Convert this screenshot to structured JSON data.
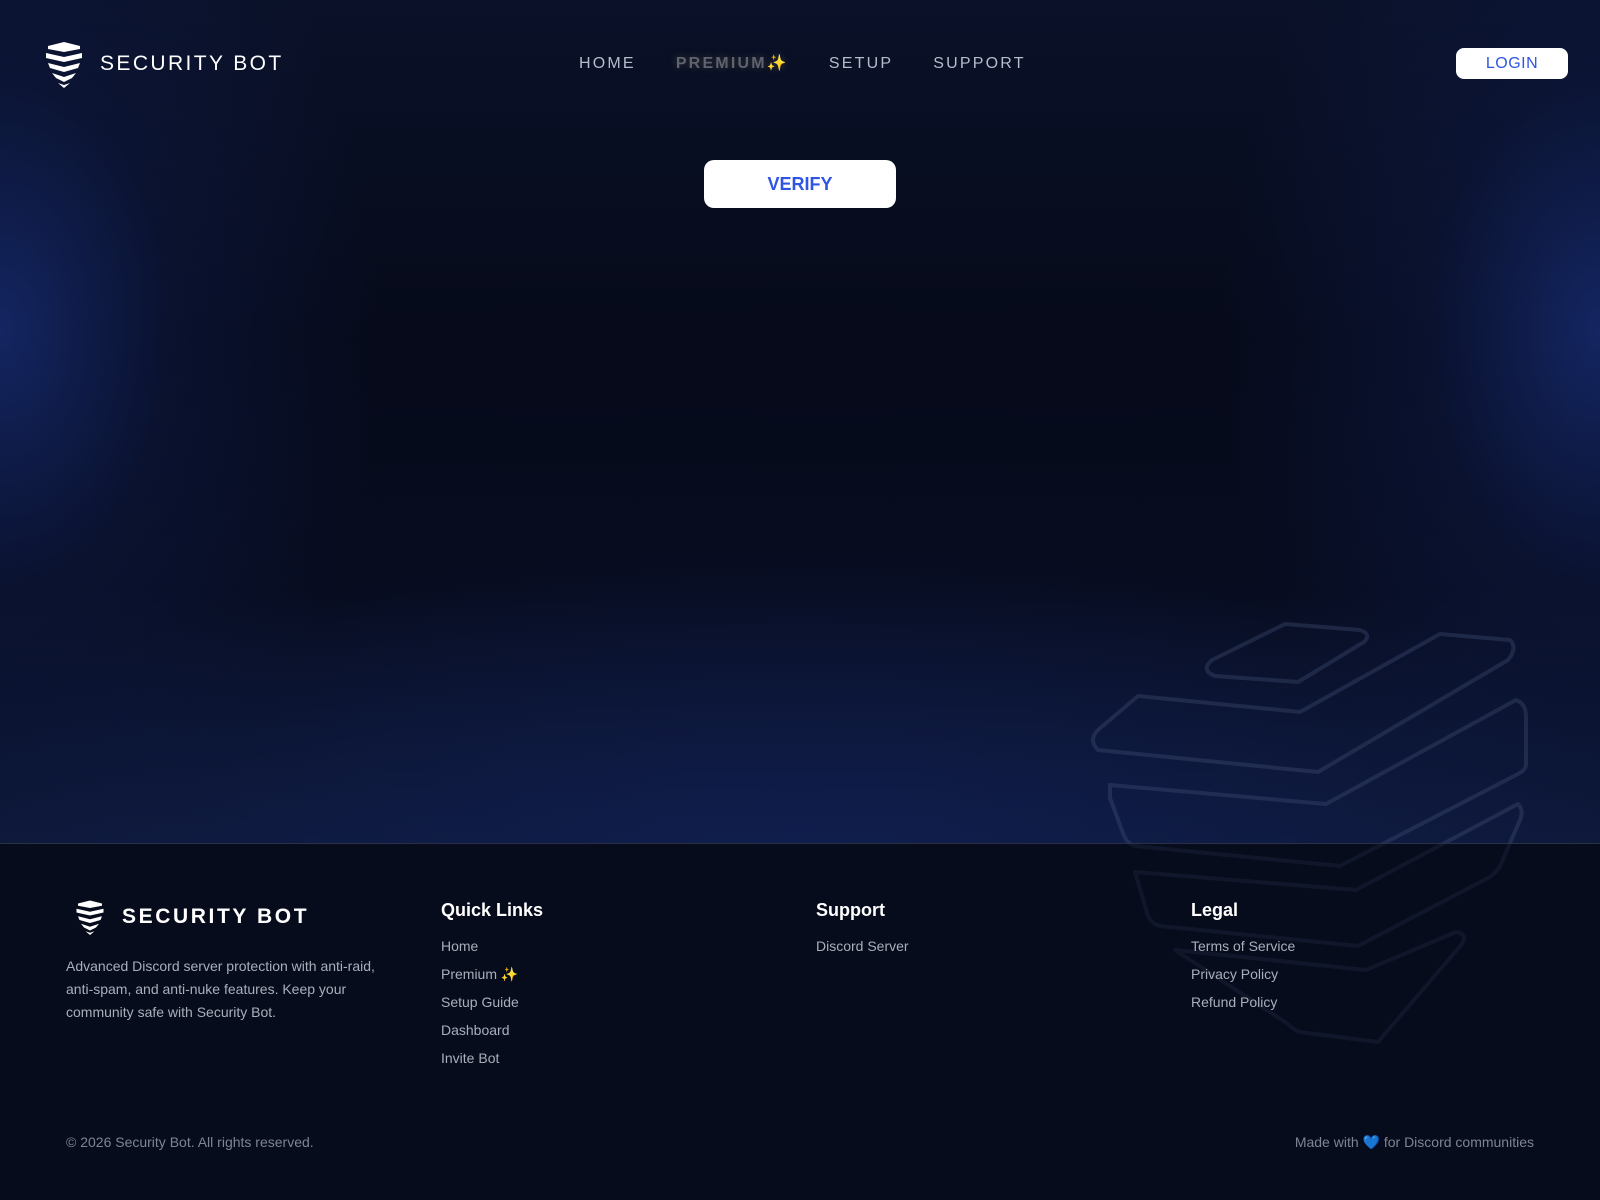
{
  "header": {
    "brand_name": "SECURITY BOT",
    "logo_icon": "shield-layers-logo",
    "nav": [
      {
        "label": "HOME"
      },
      {
        "label": "PREMIUM",
        "suffix": "✨"
      },
      {
        "label": "SETUP"
      },
      {
        "label": "SUPPORT"
      }
    ],
    "login_label": "LOGIN"
  },
  "main": {
    "verify_label": "VERIFY"
  },
  "footer": {
    "brand_name": "SECURITY BOT",
    "description": "Advanced Discord server protection with anti-raid, anti-spam, and anti-nuke features. Keep your community safe with Security Bot.",
    "columns": {
      "quick_links": {
        "title": "Quick Links",
        "items": [
          "Home",
          "Premium ✨",
          "Setup Guide",
          "Dashboard",
          "Invite Bot"
        ]
      },
      "support": {
        "title": "Support",
        "items": [
          "Discord Server"
        ]
      },
      "legal": {
        "title": "Legal",
        "items": [
          "Terms of Service",
          "Privacy Policy",
          "Refund Policy"
        ]
      }
    },
    "copyright": "© 2026 Security Bot. All rights reserved.",
    "made_with": {
      "prefix": "Made with ",
      "heart": "💙",
      "suffix": " for Discord communities"
    }
  },
  "colors": {
    "background": "#070c1c",
    "accent_blue": "#2f55e4",
    "nav_text": "#b7bccb",
    "sparkle": "#d6b43a"
  }
}
